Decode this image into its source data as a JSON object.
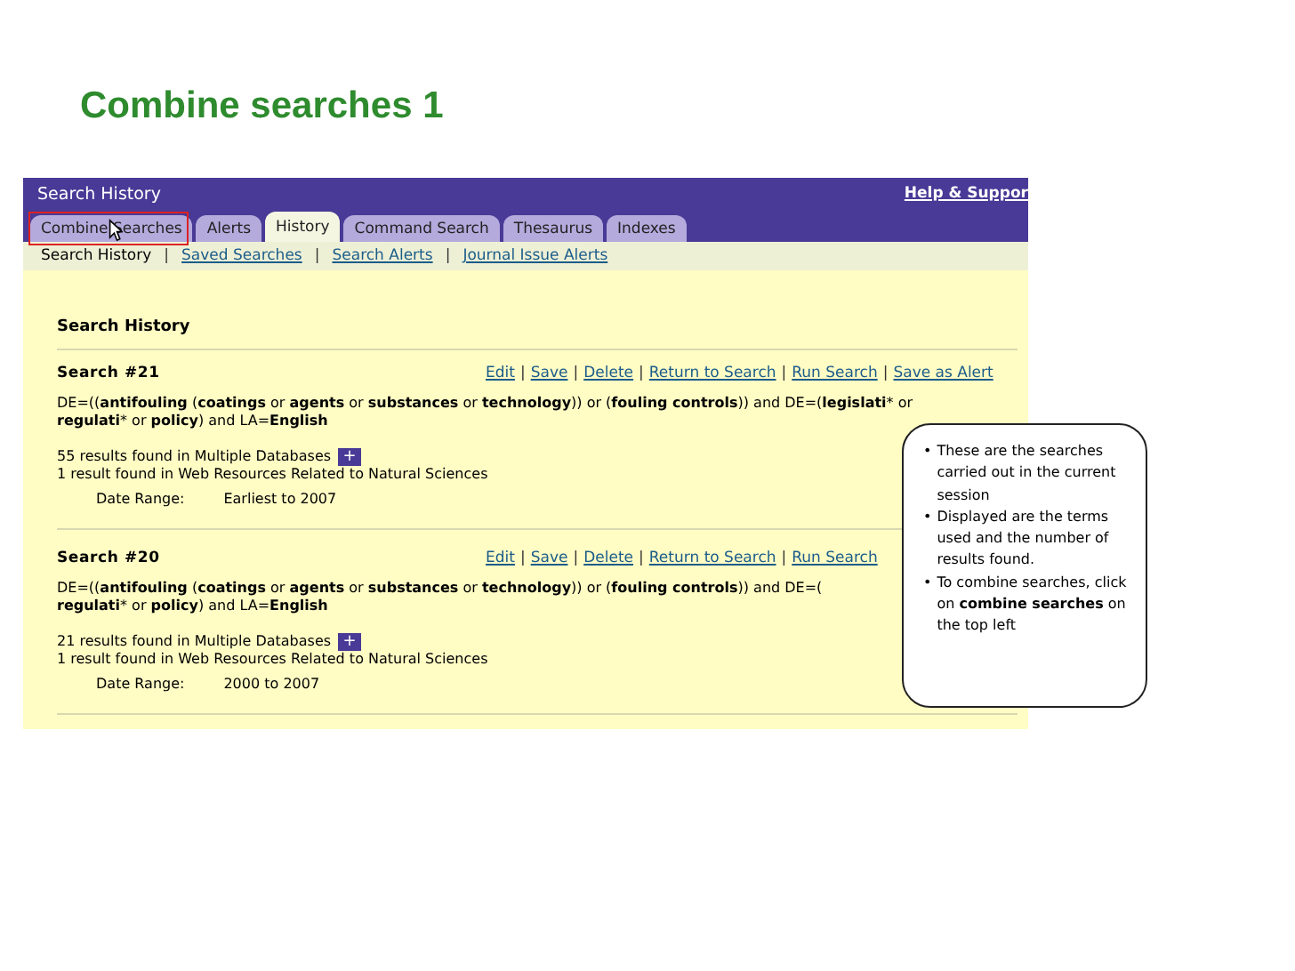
{
  "slide_title": "Combine searches 1",
  "header": {
    "title": "Search History",
    "help_link": "Help & Suppor"
  },
  "tabs": [
    {
      "label": "Combine Searches",
      "selected": false,
      "highlighted": true
    },
    {
      "label": "Alerts",
      "selected": false,
      "highlighted": false
    },
    {
      "label": "History",
      "selected": true,
      "highlighted": false
    },
    {
      "label": "Command Search",
      "selected": false,
      "highlighted": false
    },
    {
      "label": "Thesaurus",
      "selected": false,
      "highlighted": false
    },
    {
      "label": "Indexes",
      "selected": false,
      "highlighted": false
    }
  ],
  "subnav": {
    "separator": "|",
    "items": [
      {
        "label": "Search History",
        "selected": true
      },
      {
        "label": "Saved Searches",
        "selected": false
      },
      {
        "label": "Search Alerts",
        "selected": false
      },
      {
        "label": "Journal Issue Alerts",
        "selected": false
      }
    ]
  },
  "section_title": "Search History",
  "searches": [
    {
      "title": "Search #21",
      "action_separator": "|",
      "actions": [
        "Edit",
        "Save",
        "Delete",
        "Return to Search",
        "Run Search",
        "Save as Alert"
      ],
      "query_lines": [
        "DE=((**antifouling** (**coatings** or **agents** or **substances** or **technology**)) or (**fouling controls**)) and DE=(**legislati*** or",
        "**regulati*** or **policy**) and LA=**English**"
      ],
      "results": [
        {
          "text": "55 results found in Multiple Databases",
          "expand_label": "+"
        },
        {
          "text": "1 result found in Web Resources Related to Natural Sciences"
        }
      ],
      "date_label": "Date Range:",
      "date_value": "Earliest to 2007"
    },
    {
      "title": "Search #20",
      "action_separator": "|",
      "actions": [
        "Edit",
        "Save",
        "Delete",
        "Return to Search",
        "Run Search"
      ],
      "query_lines": [
        "DE=((**antifouling** (**coatings** or **agents** or **substances** or **technology**)) or (**fouling controls**)) and DE=(",
        "**regulati*** or **policy**) and LA=**English**"
      ],
      "results": [
        {
          "text": "21 results found in Multiple Databases",
          "expand_label": "+"
        },
        {
          "text": "1 result found in Web Resources Related to Natural Sciences"
        }
      ],
      "date_label": "Date Range:",
      "date_value": "2000 to 2007"
    }
  ],
  "callout": {
    "bullet": "•",
    "items": [
      "These are the searches carried out in the current session",
      "Displayed are the terms used and the number of results found.",
      "To combine searches, click on **combine searches** on the top left"
    ]
  }
}
